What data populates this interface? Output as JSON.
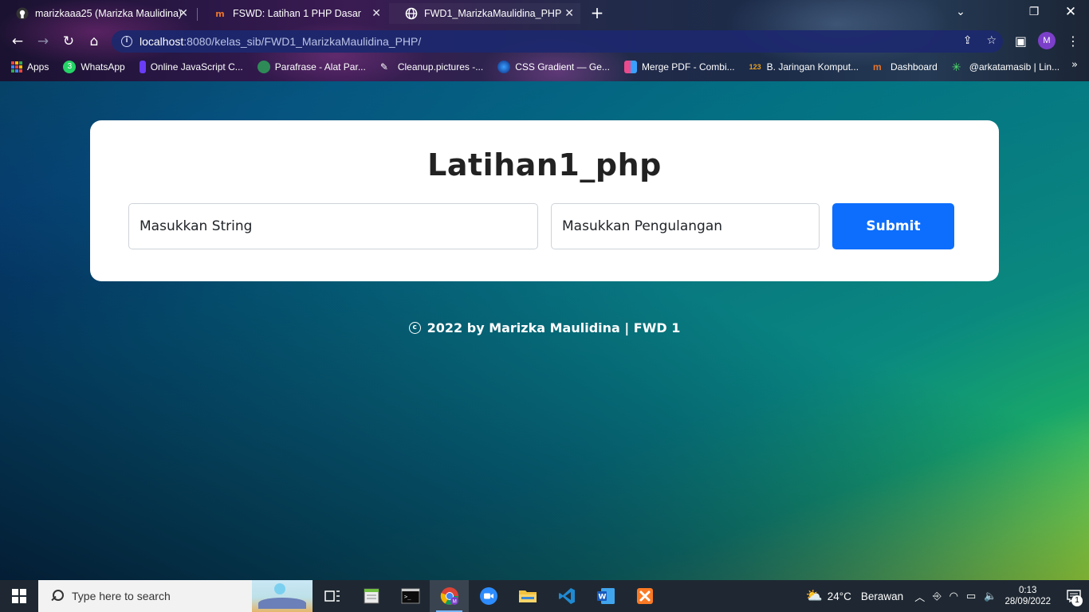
{
  "browser": {
    "tabs": [
      {
        "title": "marizkaaa25 (Marizka Maulidina)",
        "icon": "github-icon"
      },
      {
        "title": "FSWD: Latihan 1 PHP Dasar",
        "icon": "dicoding-icon"
      },
      {
        "title": "FWD1_MarizkaMaulidina_PHP",
        "icon": "globe-icon"
      }
    ],
    "url_host": "localhost",
    "url_path": ":8080/kelas_sib/FWD1_MarizkaMaulidina_PHP/",
    "profile_initial": "M",
    "bookmarks": [
      {
        "label": "Apps",
        "color": "#e8453c"
      },
      {
        "label": "WhatsApp",
        "color": "#25d366",
        "badge": "3"
      },
      {
        "label": "Online JavaScript C...",
        "color": "#6a3cf5"
      },
      {
        "label": "Parafrase - Alat Par...",
        "color": "#2e8b57"
      },
      {
        "label": "Cleanup.pictures -...",
        "color": "#ffffff"
      },
      {
        "label": "CSS Gradient — Ge...",
        "color": "#1b6fd6"
      },
      {
        "label": "Merge PDF - Combi...",
        "color": "#e94b8c"
      },
      {
        "label": "B. Jaringan Komput...",
        "color": "#e8a020"
      },
      {
        "label": "Dashboard",
        "color": "#e8742a"
      },
      {
        "label": "@arkatamasib | Lin...",
        "color": "#4ddc6a"
      }
    ]
  },
  "page": {
    "title": "Latihan1_php",
    "string_placeholder": "Masukkan String",
    "repeat_placeholder": "Masukkan Pengulangan",
    "submit_label": "Submit",
    "footer_copy_symbol": "c",
    "footer_text": "2022 by Marizka Maulidina | FWD 1"
  },
  "taskbar": {
    "search_placeholder": "Type here to search",
    "apps": [
      "task-view-icon",
      "notepad-icon",
      "terminal-icon",
      "chrome-icon",
      "zoom-icon",
      "file-explorer-icon",
      "vscode-icon",
      "word-icon",
      "xampp-icon"
    ],
    "weather_temp": "24°C",
    "weather_text": "Berawan",
    "time": "0:13",
    "date": "28/09/2022",
    "notification_count": "1"
  },
  "colors": {
    "accent_button": "#0d6efd",
    "omnibox": "#1c286e",
    "taskbar": "#1f2832"
  }
}
